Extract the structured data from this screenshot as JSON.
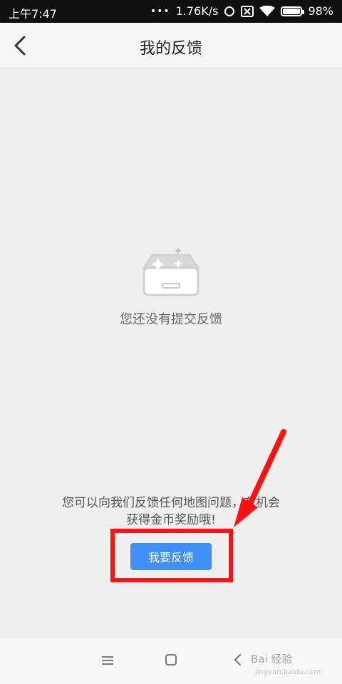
{
  "status_bar": {
    "time": "上午7:47",
    "network_speed": "1.76K/s",
    "battery": "98%"
  },
  "header": {
    "title": "我的反馈",
    "back_icon": "chevron-left-icon"
  },
  "empty_state": {
    "message": "您还没有提交反馈"
  },
  "prompt": {
    "text": "您可以向我们反馈任何地图问题，有机会获得金币奖励哦!"
  },
  "actions": {
    "feedback_button_label": "我要反馈"
  },
  "colors": {
    "primary_button": "#3f8ff7",
    "annotation_red": "#ff1111",
    "background": "#efefef"
  },
  "watermark": {
    "brand": "Bai 经验",
    "url": "jingyan.baidu.com"
  }
}
